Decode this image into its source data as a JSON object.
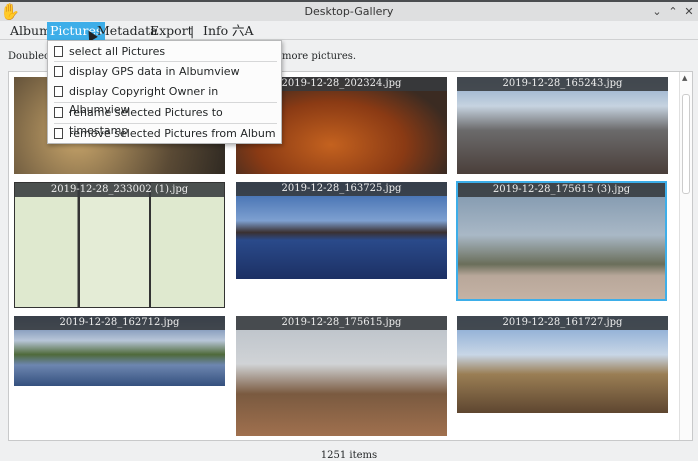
{
  "window": {
    "title": "Desktop-Gallery",
    "buttons": [
      "minimize",
      "maximize",
      "close"
    ]
  },
  "menubar": {
    "items": [
      "Album",
      "Pictures",
      "Metadata",
      "Export",
      "|",
      "Info",
      "六A"
    ],
    "active": "Pictures"
  },
  "info_text": {
    "start": "Doublecli",
    "end": "more pictures."
  },
  "pictures_menu": {
    "items": [
      "select all Pictures",
      "display GPS data in Albumview",
      "display Copyright Owner in Albumview",
      "rename selected Pictures to timestamp",
      "remove selected Pictures from Album"
    ]
  },
  "gallery": {
    "tiles": [
      {
        "name": "",
        "selected": false
      },
      {
        "name": "2019-12-28_202324.jpg",
        "selected": false
      },
      {
        "name": "2019-12-28_165243.jpg",
        "selected": false
      },
      {
        "name": "2019-12-28_233002 (1).jpg",
        "selected": false
      },
      {
        "name": "2019-12-28_163725.jpg",
        "selected": false
      },
      {
        "name": "2019-12-28_175615 (3).jpg",
        "selected": true
      },
      {
        "name": "2019-12-28_162712.jpg",
        "selected": false
      },
      {
        "name": "2019-12-28_175615.jpg",
        "selected": false
      },
      {
        "name": "2019-12-28_161727.jpg",
        "selected": false
      }
    ]
  },
  "status": {
    "count": "1251 items"
  },
  "colors": {
    "accent": "#3daee9"
  }
}
